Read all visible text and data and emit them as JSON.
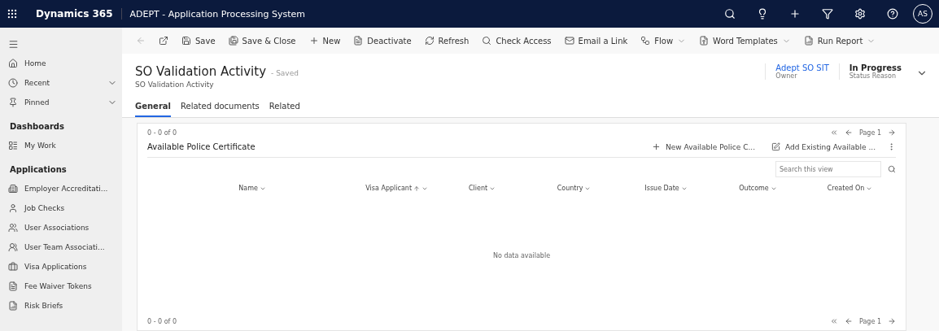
{
  "top_bar": {
    "app_name": "Dynamics 365",
    "app_title": "ADEPT - Application Processing System",
    "avatar": "AS"
  },
  "sidebar": {
    "nav": [
      {
        "label": "Home",
        "kind": "link"
      },
      {
        "label": "Recent",
        "kind": "expand"
      },
      {
        "label": "Pinned",
        "kind": "expand"
      }
    ],
    "groups": [
      {
        "title": "Dashboards",
        "items": [
          {
            "label": "My Work"
          }
        ]
      },
      {
        "title": "Applications",
        "items": [
          {
            "label": "Employer Accreditati..."
          },
          {
            "label": "Job Checks"
          },
          {
            "label": "User Associations"
          },
          {
            "label": "User Team Associati..."
          },
          {
            "label": "Visa Applications"
          },
          {
            "label": "Fee Waiver Tokens"
          },
          {
            "label": "Risk Briefs"
          }
        ]
      }
    ]
  },
  "command_bar": [
    {
      "label": "Save",
      "menu": false
    },
    {
      "label": "Save & Close",
      "menu": false
    },
    {
      "label": "New",
      "menu": false
    },
    {
      "label": "Deactivate",
      "menu": false
    },
    {
      "label": "Refresh",
      "menu": false
    },
    {
      "label": "Check Access",
      "menu": false
    },
    {
      "label": "Email a Link",
      "menu": false
    },
    {
      "label": "Flow",
      "menu": true
    },
    {
      "label": "Word Templates",
      "menu": true
    },
    {
      "label": "Run Report",
      "menu": true
    }
  ],
  "record": {
    "title": "SO Validation Activity",
    "save_state": "- Saved",
    "entity": "SO Validation Activity",
    "fields": [
      {
        "value": "Adept SO SIT",
        "label": "Owner",
        "kind": "link"
      },
      {
        "value": "In Progress",
        "label": "Status Reason",
        "kind": "text"
      }
    ]
  },
  "tabs": [
    {
      "label": "General",
      "selected": true
    },
    {
      "label": "Related documents",
      "selected": false
    },
    {
      "label": "Related",
      "selected": false
    }
  ],
  "subgrid": {
    "top_count": "0 - 0 of 0",
    "page": "Page 1",
    "title": "Available Police Certificate",
    "actions": [
      {
        "label": "New Available Police C..."
      },
      {
        "label": "Add Existing Available ..."
      }
    ],
    "search": {
      "placeholder": "Search this view"
    },
    "columns": [
      {
        "label": "Name",
        "sorted": false
      },
      {
        "label": "Visa Applicant",
        "sorted": true
      },
      {
        "label": "Client",
        "sorted": false
      },
      {
        "label": "Country",
        "sorted": false
      },
      {
        "label": "Issue Date",
        "sorted": false
      },
      {
        "label": "Outcome",
        "sorted": false
      },
      {
        "label": "Created On",
        "sorted": false
      }
    ],
    "empty_text": "No data available",
    "bottom_count": "0 - 0 of 0",
    "bottom_page": "Page 1"
  }
}
